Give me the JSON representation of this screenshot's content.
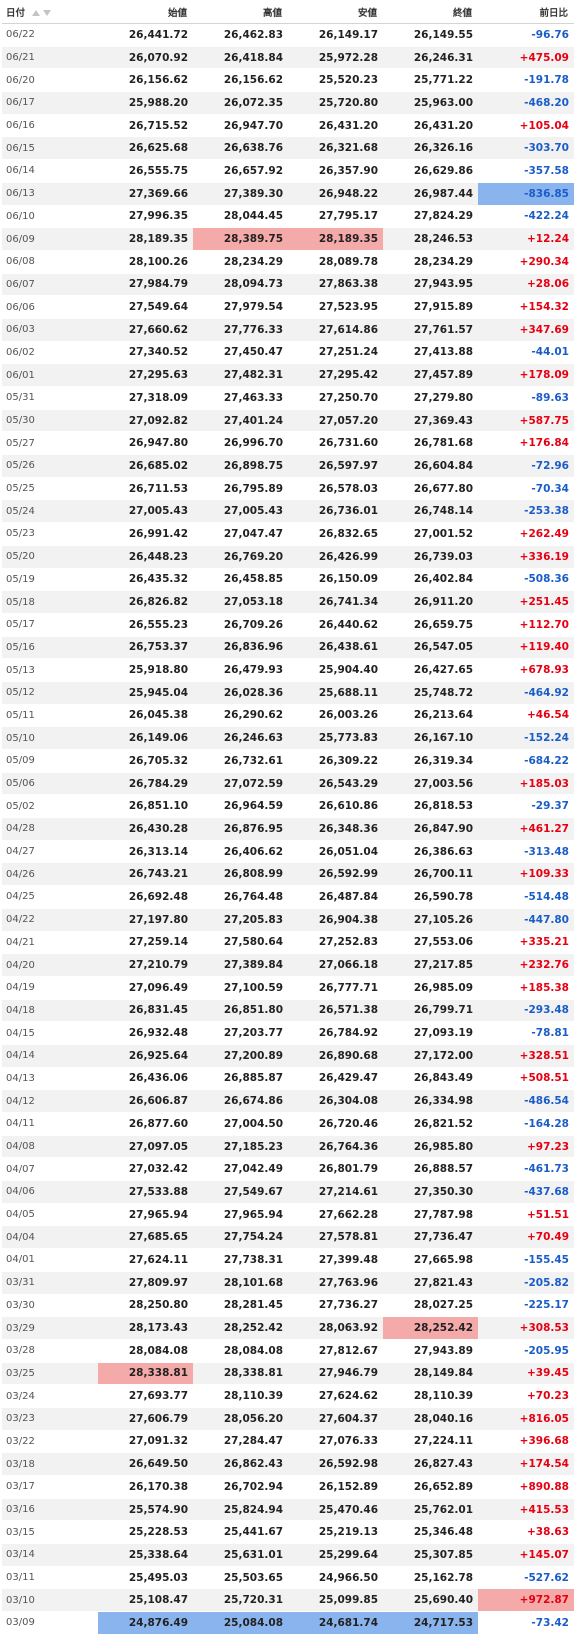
{
  "header": {
    "date": "日付",
    "open": "始値",
    "high": "高値",
    "low": "安値",
    "close": "終値",
    "change": "前日比"
  },
  "colors": {
    "positive": "#e60012",
    "negative": "#1a5cc8",
    "highlight_red": "#f4aaa8",
    "highlight_blue": "#8ab4ee",
    "row_alt": "#f2f2f2"
  },
  "icons": {
    "sort_asc": "triangle-up-icon",
    "sort_desc": "triangle-down-icon"
  },
  "rows": [
    {
      "date": "06/22",
      "open": "26,441.72",
      "high": "26,462.83",
      "low": "26,149.17",
      "close": "26,149.55",
      "change": "-96.76",
      "hl": {}
    },
    {
      "date": "06/21",
      "open": "26,070.92",
      "high": "26,418.84",
      "low": "25,972.28",
      "close": "26,246.31",
      "change": "+475.09",
      "hl": {}
    },
    {
      "date": "06/20",
      "open": "26,156.62",
      "high": "26,156.62",
      "low": "25,520.23",
      "close": "25,771.22",
      "change": "-191.78",
      "hl": {}
    },
    {
      "date": "06/17",
      "open": "25,988.20",
      "high": "26,072.35",
      "low": "25,720.80",
      "close": "25,963.00",
      "change": "-468.20",
      "hl": {}
    },
    {
      "date": "06/16",
      "open": "26,715.52",
      "high": "26,947.70",
      "low": "26,431.20",
      "close": "26,431.20",
      "change": "+105.04",
      "hl": {}
    },
    {
      "date": "06/15",
      "open": "26,625.68",
      "high": "26,638.76",
      "low": "26,321.68",
      "close": "26,326.16",
      "change": "-303.70",
      "hl": {}
    },
    {
      "date": "06/14",
      "open": "26,555.75",
      "high": "26,657.92",
      "low": "26,357.90",
      "close": "26,629.86",
      "change": "-357.58",
      "hl": {}
    },
    {
      "date": "06/13",
      "open": "27,369.66",
      "high": "27,389.30",
      "low": "26,948.22",
      "close": "26,987.44",
      "change": "-836.85",
      "hl": {
        "change": "blue"
      }
    },
    {
      "date": "06/10",
      "open": "27,996.35",
      "high": "28,044.45",
      "low": "27,795.17",
      "close": "27,824.29",
      "change": "-422.24",
      "hl": {}
    },
    {
      "date": "06/09",
      "open": "28,189.35",
      "high": "28,389.75",
      "low": "28,189.35",
      "close": "28,246.53",
      "change": "+12.24",
      "hl": {
        "high": "red",
        "low": "red"
      }
    },
    {
      "date": "06/08",
      "open": "28,100.26",
      "high": "28,234.29",
      "low": "28,089.78",
      "close": "28,234.29",
      "change": "+290.34",
      "hl": {}
    },
    {
      "date": "06/07",
      "open": "27,984.79",
      "high": "28,094.73",
      "low": "27,863.38",
      "close": "27,943.95",
      "change": "+28.06",
      "hl": {}
    },
    {
      "date": "06/06",
      "open": "27,549.64",
      "high": "27,979.54",
      "low": "27,523.95",
      "close": "27,915.89",
      "change": "+154.32",
      "hl": {}
    },
    {
      "date": "06/03",
      "open": "27,660.62",
      "high": "27,776.33",
      "low": "27,614.86",
      "close": "27,761.57",
      "change": "+347.69",
      "hl": {}
    },
    {
      "date": "06/02",
      "open": "27,340.52",
      "high": "27,450.47",
      "low": "27,251.24",
      "close": "27,413.88",
      "change": "-44.01",
      "hl": {}
    },
    {
      "date": "06/01",
      "open": "27,295.63",
      "high": "27,482.31",
      "low": "27,295.42",
      "close": "27,457.89",
      "change": "+178.09",
      "hl": {}
    },
    {
      "date": "05/31",
      "open": "27,318.09",
      "high": "27,463.33",
      "low": "27,250.70",
      "close": "27,279.80",
      "change": "-89.63",
      "hl": {}
    },
    {
      "date": "05/30",
      "open": "27,092.82",
      "high": "27,401.24",
      "low": "27,057.20",
      "close": "27,369.43",
      "change": "+587.75",
      "hl": {}
    },
    {
      "date": "05/27",
      "open": "26,947.80",
      "high": "26,996.70",
      "low": "26,731.60",
      "close": "26,781.68",
      "change": "+176.84",
      "hl": {}
    },
    {
      "date": "05/26",
      "open": "26,685.02",
      "high": "26,898.75",
      "low": "26,597.97",
      "close": "26,604.84",
      "change": "-72.96",
      "hl": {}
    },
    {
      "date": "05/25",
      "open": "26,711.53",
      "high": "26,795.89",
      "low": "26,578.03",
      "close": "26,677.80",
      "change": "-70.34",
      "hl": {}
    },
    {
      "date": "05/24",
      "open": "27,005.43",
      "high": "27,005.43",
      "low": "26,736.01",
      "close": "26,748.14",
      "change": "-253.38",
      "hl": {}
    },
    {
      "date": "05/23",
      "open": "26,991.42",
      "high": "27,047.47",
      "low": "26,832.65",
      "close": "27,001.52",
      "change": "+262.49",
      "hl": {}
    },
    {
      "date": "05/20",
      "open": "26,448.23",
      "high": "26,769.20",
      "low": "26,426.99",
      "close": "26,739.03",
      "change": "+336.19",
      "hl": {}
    },
    {
      "date": "05/19",
      "open": "26,435.32",
      "high": "26,458.85",
      "low": "26,150.09",
      "close": "26,402.84",
      "change": "-508.36",
      "hl": {}
    },
    {
      "date": "05/18",
      "open": "26,826.82",
      "high": "27,053.18",
      "low": "26,741.34",
      "close": "26,911.20",
      "change": "+251.45",
      "hl": {}
    },
    {
      "date": "05/17",
      "open": "26,555.23",
      "high": "26,709.26",
      "low": "26,440.62",
      "close": "26,659.75",
      "change": "+112.70",
      "hl": {}
    },
    {
      "date": "05/16",
      "open": "26,753.37",
      "high": "26,836.96",
      "low": "26,438.61",
      "close": "26,547.05",
      "change": "+119.40",
      "hl": {}
    },
    {
      "date": "05/13",
      "open": "25,918.80",
      "high": "26,479.93",
      "low": "25,904.40",
      "close": "26,427.65",
      "change": "+678.93",
      "hl": {}
    },
    {
      "date": "05/12",
      "open": "25,945.04",
      "high": "26,028.36",
      "low": "25,688.11",
      "close": "25,748.72",
      "change": "-464.92",
      "hl": {}
    },
    {
      "date": "05/11",
      "open": "26,045.38",
      "high": "26,290.62",
      "low": "26,003.26",
      "close": "26,213.64",
      "change": "+46.54",
      "hl": {}
    },
    {
      "date": "05/10",
      "open": "26,149.06",
      "high": "26,246.63",
      "low": "25,773.83",
      "close": "26,167.10",
      "change": "-152.24",
      "hl": {}
    },
    {
      "date": "05/09",
      "open": "26,705.32",
      "high": "26,732.61",
      "low": "26,309.22",
      "close": "26,319.34",
      "change": "-684.22",
      "hl": {}
    },
    {
      "date": "05/06",
      "open": "26,784.29",
      "high": "27,072.59",
      "low": "26,543.29",
      "close": "27,003.56",
      "change": "+185.03",
      "hl": {}
    },
    {
      "date": "05/02",
      "open": "26,851.10",
      "high": "26,964.59",
      "low": "26,610.86",
      "close": "26,818.53",
      "change": "-29.37",
      "hl": {}
    },
    {
      "date": "04/28",
      "open": "26,430.28",
      "high": "26,876.95",
      "low": "26,348.36",
      "close": "26,847.90",
      "change": "+461.27",
      "hl": {}
    },
    {
      "date": "04/27",
      "open": "26,313.14",
      "high": "26,406.62",
      "low": "26,051.04",
      "close": "26,386.63",
      "change": "-313.48",
      "hl": {}
    },
    {
      "date": "04/26",
      "open": "26,743.21",
      "high": "26,808.99",
      "low": "26,592.99",
      "close": "26,700.11",
      "change": "+109.33",
      "hl": {}
    },
    {
      "date": "04/25",
      "open": "26,692.48",
      "high": "26,764.48",
      "low": "26,487.84",
      "close": "26,590.78",
      "change": "-514.48",
      "hl": {}
    },
    {
      "date": "04/22",
      "open": "27,197.80",
      "high": "27,205.83",
      "low": "26,904.38",
      "close": "27,105.26",
      "change": "-447.80",
      "hl": {}
    },
    {
      "date": "04/21",
      "open": "27,259.14",
      "high": "27,580.64",
      "low": "27,252.83",
      "close": "27,553.06",
      "change": "+335.21",
      "hl": {}
    },
    {
      "date": "04/20",
      "open": "27,210.79",
      "high": "27,389.84",
      "low": "27,066.18",
      "close": "27,217.85",
      "change": "+232.76",
      "hl": {}
    },
    {
      "date": "04/19",
      "open": "27,096.49",
      "high": "27,100.59",
      "low": "26,777.71",
      "close": "26,985.09",
      "change": "+185.38",
      "hl": {}
    },
    {
      "date": "04/18",
      "open": "26,831.45",
      "high": "26,851.80",
      "low": "26,571.38",
      "close": "26,799.71",
      "change": "-293.48",
      "hl": {}
    },
    {
      "date": "04/15",
      "open": "26,932.48",
      "high": "27,203.77",
      "low": "26,784.92",
      "close": "27,093.19",
      "change": "-78.81",
      "hl": {}
    },
    {
      "date": "04/14",
      "open": "26,925.64",
      "high": "27,200.89",
      "low": "26,890.68",
      "close": "27,172.00",
      "change": "+328.51",
      "hl": {}
    },
    {
      "date": "04/13",
      "open": "26,436.06",
      "high": "26,885.87",
      "low": "26,429.47",
      "close": "26,843.49",
      "change": "+508.51",
      "hl": {}
    },
    {
      "date": "04/12",
      "open": "26,606.87",
      "high": "26,674.86",
      "low": "26,304.08",
      "close": "26,334.98",
      "change": "-486.54",
      "hl": {}
    },
    {
      "date": "04/11",
      "open": "26,877.60",
      "high": "27,004.50",
      "low": "26,720.46",
      "close": "26,821.52",
      "change": "-164.28",
      "hl": {}
    },
    {
      "date": "04/08",
      "open": "27,097.05",
      "high": "27,185.23",
      "low": "26,764.36",
      "close": "26,985.80",
      "change": "+97.23",
      "hl": {}
    },
    {
      "date": "04/07",
      "open": "27,032.42",
      "high": "27,042.49",
      "low": "26,801.79",
      "close": "26,888.57",
      "change": "-461.73",
      "hl": {}
    },
    {
      "date": "04/06",
      "open": "27,533.88",
      "high": "27,549.67",
      "low": "27,214.61",
      "close": "27,350.30",
      "change": "-437.68",
      "hl": {}
    },
    {
      "date": "04/05",
      "open": "27,965.94",
      "high": "27,965.94",
      "low": "27,662.28",
      "close": "27,787.98",
      "change": "+51.51",
      "hl": {}
    },
    {
      "date": "04/04",
      "open": "27,685.65",
      "high": "27,754.24",
      "low": "27,578.81",
      "close": "27,736.47",
      "change": "+70.49",
      "hl": {}
    },
    {
      "date": "04/01",
      "open": "27,624.11",
      "high": "27,738.31",
      "low": "27,399.48",
      "close": "27,665.98",
      "change": "-155.45",
      "hl": {}
    },
    {
      "date": "03/31",
      "open": "27,809.97",
      "high": "28,101.68",
      "low": "27,763.96",
      "close": "27,821.43",
      "change": "-205.82",
      "hl": {}
    },
    {
      "date": "03/30",
      "open": "28,250.80",
      "high": "28,281.45",
      "low": "27,736.27",
      "close": "28,027.25",
      "change": "-225.17",
      "hl": {}
    },
    {
      "date": "03/29",
      "open": "28,173.43",
      "high": "28,252.42",
      "low": "28,063.92",
      "close": "28,252.42",
      "change": "+308.53",
      "hl": {
        "close": "red"
      }
    },
    {
      "date": "03/28",
      "open": "28,084.08",
      "high": "28,084.08",
      "low": "27,812.67",
      "close": "27,943.89",
      "change": "-205.95",
      "hl": {}
    },
    {
      "date": "03/25",
      "open": "28,338.81",
      "high": "28,338.81",
      "low": "27,946.79",
      "close": "28,149.84",
      "change": "+39.45",
      "hl": {
        "open": "red"
      }
    },
    {
      "date": "03/24",
      "open": "27,693.77",
      "high": "28,110.39",
      "low": "27,624.62",
      "close": "28,110.39",
      "change": "+70.23",
      "hl": {}
    },
    {
      "date": "03/23",
      "open": "27,606.79",
      "high": "28,056.20",
      "low": "27,604.37",
      "close": "28,040.16",
      "change": "+816.05",
      "hl": {}
    },
    {
      "date": "03/22",
      "open": "27,091.32",
      "high": "27,284.47",
      "low": "27,076.33",
      "close": "27,224.11",
      "change": "+396.68",
      "hl": {}
    },
    {
      "date": "03/18",
      "open": "26,649.50",
      "high": "26,862.43",
      "low": "26,592.98",
      "close": "26,827.43",
      "change": "+174.54",
      "hl": {}
    },
    {
      "date": "03/17",
      "open": "26,170.38",
      "high": "26,702.94",
      "low": "26,152.89",
      "close": "26,652.89",
      "change": "+890.88",
      "hl": {}
    },
    {
      "date": "03/16",
      "open": "25,574.90",
      "high": "25,824.94",
      "low": "25,470.46",
      "close": "25,762.01",
      "change": "+415.53",
      "hl": {}
    },
    {
      "date": "03/15",
      "open": "25,228.53",
      "high": "25,441.67",
      "low": "25,219.13",
      "close": "25,346.48",
      "change": "+38.63",
      "hl": {}
    },
    {
      "date": "03/14",
      "open": "25,338.64",
      "high": "25,631.01",
      "low": "25,299.64",
      "close": "25,307.85",
      "change": "+145.07",
      "hl": {}
    },
    {
      "date": "03/11",
      "open": "25,495.03",
      "high": "25,503.65",
      "low": "24,966.50",
      "close": "25,162.78",
      "change": "-527.62",
      "hl": {}
    },
    {
      "date": "03/10",
      "open": "25,108.47",
      "high": "25,720.31",
      "low": "25,099.85",
      "close": "25,690.40",
      "change": "+972.87",
      "hl": {
        "change": "red"
      }
    },
    {
      "date": "03/09",
      "open": "24,876.49",
      "high": "25,084.08",
      "low": "24,681.74",
      "close": "24,717.53",
      "change": "-73.42",
      "hl": {
        "open": "blue",
        "high": "blue",
        "low": "blue",
        "close": "blue"
      }
    }
  ]
}
